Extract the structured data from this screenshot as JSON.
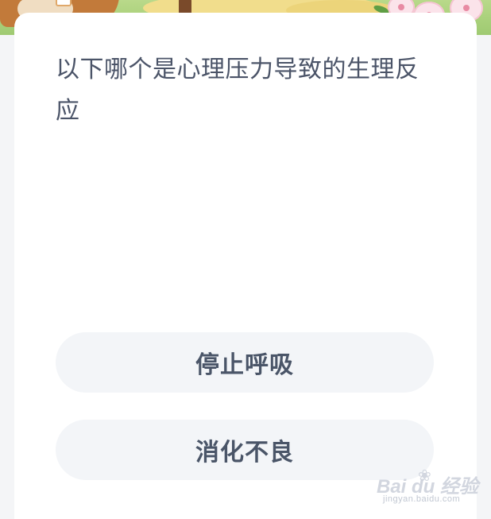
{
  "question": {
    "text": "以下哪个是心理压力导致的生理反应"
  },
  "options": [
    {
      "label": "停止呼吸"
    },
    {
      "label": "消化不良"
    }
  ],
  "watermark": {
    "brand": "Bai du 经验",
    "url": "jingyan.baidu.com",
    "icon": "paw-icon"
  },
  "colors": {
    "question_text": "#4b5468",
    "option_bg": "#f3f5f8",
    "option_text": "#4a5568",
    "card_bg": "#ffffff",
    "page_bg": "#f4f5f7"
  }
}
